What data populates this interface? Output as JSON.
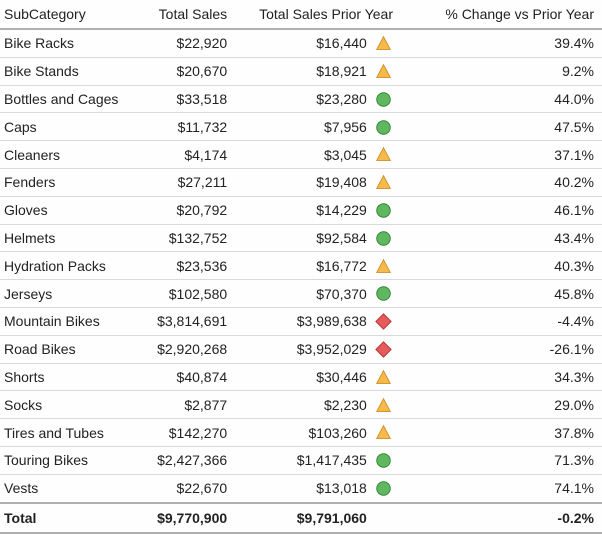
{
  "chart_data": {
    "type": "table",
    "title": "",
    "columns": [
      "SubCategory",
      "Total Sales",
      "Total Sales Prior Year",
      "% Change vs Prior Year"
    ],
    "rows": [
      {
        "subcategory": "Bike Racks",
        "total_sales": 22920,
        "prior_year": 16440,
        "pct_change": 39.4,
        "indicator": "up"
      },
      {
        "subcategory": "Bike Stands",
        "total_sales": 20670,
        "prior_year": 18921,
        "pct_change": 9.2,
        "indicator": "up"
      },
      {
        "subcategory": "Bottles and Cages",
        "total_sales": 33518,
        "prior_year": 23280,
        "pct_change": 44.0,
        "indicator": "good"
      },
      {
        "subcategory": "Caps",
        "total_sales": 11732,
        "prior_year": 7956,
        "pct_change": 47.5,
        "indicator": "good"
      },
      {
        "subcategory": "Cleaners",
        "total_sales": 4174,
        "prior_year": 3045,
        "pct_change": 37.1,
        "indicator": "up"
      },
      {
        "subcategory": "Fenders",
        "total_sales": 27211,
        "prior_year": 19408,
        "pct_change": 40.2,
        "indicator": "up"
      },
      {
        "subcategory": "Gloves",
        "total_sales": 20792,
        "prior_year": 14229,
        "pct_change": 46.1,
        "indicator": "good"
      },
      {
        "subcategory": "Helmets",
        "total_sales": 132752,
        "prior_year": 92584,
        "pct_change": 43.4,
        "indicator": "good"
      },
      {
        "subcategory": "Hydration Packs",
        "total_sales": 23536,
        "prior_year": 16772,
        "pct_change": 40.3,
        "indicator": "up"
      },
      {
        "subcategory": "Jerseys",
        "total_sales": 102580,
        "prior_year": 70370,
        "pct_change": 45.8,
        "indicator": "good"
      },
      {
        "subcategory": "Mountain Bikes",
        "total_sales": 3814691,
        "prior_year": 3989638,
        "pct_change": -4.4,
        "indicator": "bad"
      },
      {
        "subcategory": "Road Bikes",
        "total_sales": 2920268,
        "prior_year": 3952029,
        "pct_change": -26.1,
        "indicator": "bad"
      },
      {
        "subcategory": "Shorts",
        "total_sales": 40874,
        "prior_year": 30446,
        "pct_change": 34.3,
        "indicator": "up"
      },
      {
        "subcategory": "Socks",
        "total_sales": 2877,
        "prior_year": 2230,
        "pct_change": 29.0,
        "indicator": "up"
      },
      {
        "subcategory": "Tires and Tubes",
        "total_sales": 142270,
        "prior_year": 103260,
        "pct_change": 37.8,
        "indicator": "up"
      },
      {
        "subcategory": "Touring Bikes",
        "total_sales": 2427366,
        "prior_year": 1417435,
        "pct_change": 71.3,
        "indicator": "good"
      },
      {
        "subcategory": "Vests",
        "total_sales": 22670,
        "prior_year": 13018,
        "pct_change": 74.1,
        "indicator": "good"
      }
    ],
    "totals": {
      "label": "Total",
      "total_sales": 9770900,
      "prior_year": 9791060,
      "pct_change": -0.2
    }
  },
  "colors": {
    "up": {
      "fill": "#f6b94a",
      "stroke": "#c98a1b"
    },
    "good": {
      "fill": "#5fb85f",
      "stroke": "#2e7d32"
    },
    "bad": {
      "fill": "#e55b5b",
      "stroke": "#b12727"
    }
  },
  "headers": {
    "subcategory": "SubCategory",
    "total_sales": "Total Sales",
    "prior_year": "Total Sales Prior Year",
    "pct_change": "% Change vs Prior Year"
  }
}
